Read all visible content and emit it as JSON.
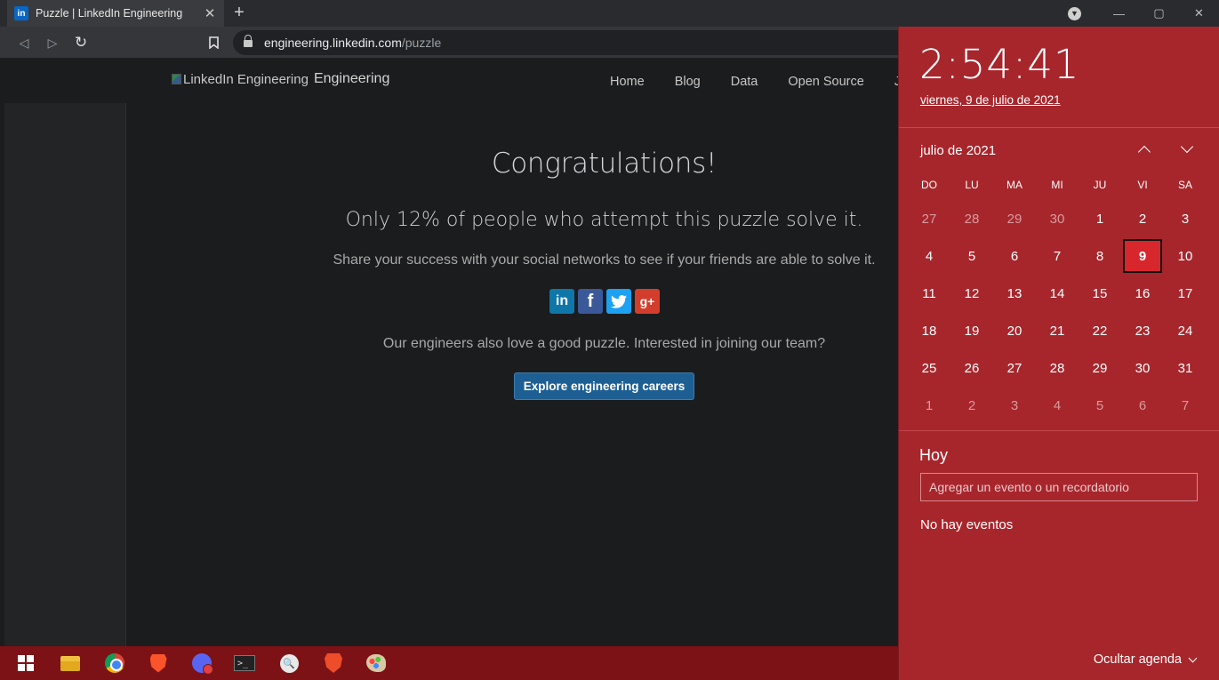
{
  "browser": {
    "tab_title": "Puzzle | LinkedIn Engineering",
    "tab_favicon": "in",
    "new_tab": "+",
    "url_host": "engineering.linkedin.com",
    "url_path": "/puzzle",
    "minimize": "—",
    "maximize": "▢",
    "close": "✕",
    "tab_close": "✕",
    "back": "◁",
    "forward": "▷",
    "reload": "↻",
    "bookmark_icon": "bookmark-icon"
  },
  "site": {
    "logo_alt": "LinkedIn Engineering",
    "logo_suffix": "Engineering",
    "nav": [
      "Home",
      "Blog",
      "Data",
      "Open Source",
      "J"
    ]
  },
  "main": {
    "heading": "Congratulations!",
    "subheading": "Only 12% of people who attempt this puzzle solve it.",
    "share_text": "Share your success with your social networks to see if your friends are able to solve it.",
    "social": {
      "linkedin": "in",
      "facebook": "f",
      "twitter": "🐦",
      "googleplus": "g+"
    },
    "team_text": "Our engineers also love a good puzzle. Interested in joining our team?",
    "cta_label": "Explore engineering careers"
  },
  "calendar": {
    "time": "2:54:41",
    "date": "viernes, 9 de julio de 2021",
    "month": "julio de 2021",
    "weekdays": [
      "DO",
      "LU",
      "MA",
      "MI",
      "JU",
      "VI",
      "SA"
    ],
    "weeks": [
      [
        "27",
        "28",
        "29",
        "30",
        "1",
        "2",
        "3"
      ],
      [
        "4",
        "5",
        "6",
        "7",
        "8",
        "9",
        "10"
      ],
      [
        "11",
        "12",
        "13",
        "14",
        "15",
        "16",
        "17"
      ],
      [
        "18",
        "19",
        "20",
        "21",
        "22",
        "23",
        "24"
      ],
      [
        "25",
        "26",
        "27",
        "28",
        "29",
        "30",
        "31"
      ],
      [
        "1",
        "2",
        "3",
        "4",
        "5",
        "6",
        "7"
      ]
    ],
    "today_label": "Hoy",
    "event_placeholder": "Agregar un evento o un recordatorio",
    "no_events": "No hay eventos",
    "hide_agenda": "Ocultar agenda",
    "accent_color": "#a7262c",
    "today_color": "#d8272c"
  },
  "taskbar": {
    "icons": [
      "windows-start-icon",
      "file-explorer-icon",
      "chrome-icon",
      "brave-icon",
      "discord-icon",
      "terminal-icon",
      "search-app-icon",
      "brave-nightly-icon",
      "paint-icon"
    ],
    "terminal_glyph": ">_",
    "search_glyph": "🔍"
  }
}
